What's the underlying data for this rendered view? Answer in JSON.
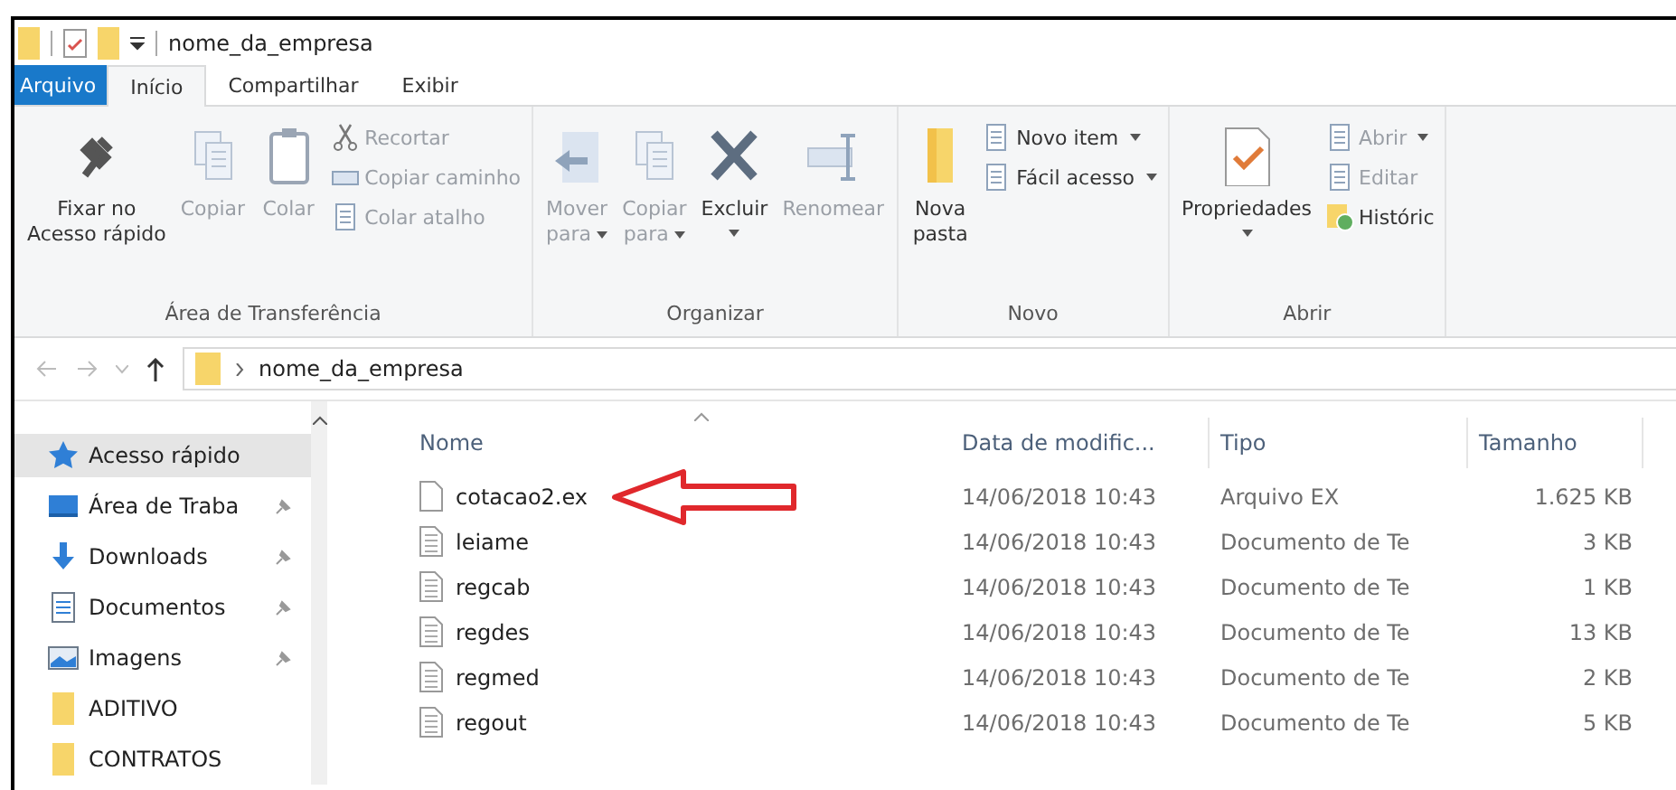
{
  "window": {
    "title": "nome_da_empresa"
  },
  "tabs": [
    {
      "label": "Arquivo",
      "kind": "file"
    },
    {
      "label": "Início",
      "selected": true,
      "kind": "tab"
    },
    {
      "label": "Compartilhar",
      "selected": false,
      "kind": "tab"
    },
    {
      "label": "Exibir",
      "selected": false,
      "kind": "tab"
    }
  ],
  "ribbon": [
    {
      "label": "Área de Transferência",
      "items": [
        {
          "kind": "large",
          "label": "Fixar no\nAcesso rápido",
          "disabled": false
        },
        {
          "kind": "large",
          "label": "Copiar",
          "disabled": true
        },
        {
          "kind": "large",
          "label": "Colar",
          "disabled": true
        },
        {
          "kind": "stack",
          "items": [
            {
              "label": "Recortar",
              "disabled": true
            },
            {
              "label": "Copiar caminho",
              "disabled": true
            },
            {
              "label": "Colar atalho",
              "disabled": true
            }
          ]
        }
      ]
    },
    {
      "label": "Organizar",
      "items": [
        {
          "kind": "large",
          "label": "Mover\npara",
          "dropdown": true,
          "disabled": true
        },
        {
          "kind": "large",
          "label": "Copiar\npara",
          "dropdown": true,
          "disabled": true
        },
        {
          "kind": "large",
          "label": "Excluir",
          "dropdown": true,
          "disabled": false
        },
        {
          "kind": "large",
          "label": "Renomear",
          "disabled": true
        }
      ]
    },
    {
      "label": "Novo",
      "items": [
        {
          "kind": "large",
          "label": "Nova\npasta",
          "disabled": false
        },
        {
          "kind": "stack",
          "items": [
            {
              "label": "Novo item",
              "dropdown": true,
              "disabled": false
            },
            {
              "label": "Fácil acesso",
              "dropdown": true,
              "disabled": false
            }
          ]
        }
      ]
    },
    {
      "label": "Abrir",
      "items": [
        {
          "kind": "large",
          "label": "Propriedades",
          "dropdown": true,
          "disabled": false
        },
        {
          "kind": "stack",
          "items": [
            {
              "label": "Abrir",
              "dropdown": true,
              "disabled": true
            },
            {
              "label": "Editar",
              "disabled": true
            },
            {
              "label": "Históric",
              "disabled": false
            }
          ]
        }
      ]
    }
  ],
  "address": {
    "path": "nome_da_empresa"
  },
  "sidebar": {
    "items": [
      {
        "label": "Acesso rápido",
        "kind": "star",
        "selected": true,
        "pinned": false
      },
      {
        "label": "Área de Traba",
        "kind": "desktop",
        "selected": false,
        "pinned": true
      },
      {
        "label": "Downloads",
        "kind": "download",
        "selected": false,
        "pinned": true
      },
      {
        "label": "Documentos",
        "kind": "document",
        "selected": false,
        "pinned": true
      },
      {
        "label": "Imagens",
        "kind": "image",
        "selected": false,
        "pinned": true
      },
      {
        "label": "ADITIVO",
        "kind": "folder",
        "selected": false,
        "pinned": false
      },
      {
        "label": "CONTRATOS",
        "kind": "folder",
        "selected": false,
        "pinned": false
      }
    ]
  },
  "table": {
    "columns": [
      "Nome",
      "Data de modific...",
      "Tipo",
      "Tamanho"
    ],
    "rows": [
      {
        "name": "cotacao2.ex",
        "date": "14/06/2018 10:43",
        "type": "Arquivo EX",
        "size": "1.625 KB",
        "kind": "blank"
      },
      {
        "name": "leiame",
        "date": "14/06/2018 10:43",
        "type": "Documento de Te",
        "size": "3 KB",
        "kind": "text"
      },
      {
        "name": "regcab",
        "date": "14/06/2018 10:43",
        "type": "Documento de Te",
        "size": "1 KB",
        "kind": "text"
      },
      {
        "name": "regdes",
        "date": "14/06/2018 10:43",
        "type": "Documento de Te",
        "size": "13 KB",
        "kind": "text"
      },
      {
        "name": "regmed",
        "date": "14/06/2018 10:43",
        "type": "Documento de Te",
        "size": "2 KB",
        "kind": "text"
      },
      {
        "name": "regout",
        "date": "14/06/2018 10:43",
        "type": "Documento de Te",
        "size": "5 KB",
        "kind": "text"
      }
    ]
  }
}
